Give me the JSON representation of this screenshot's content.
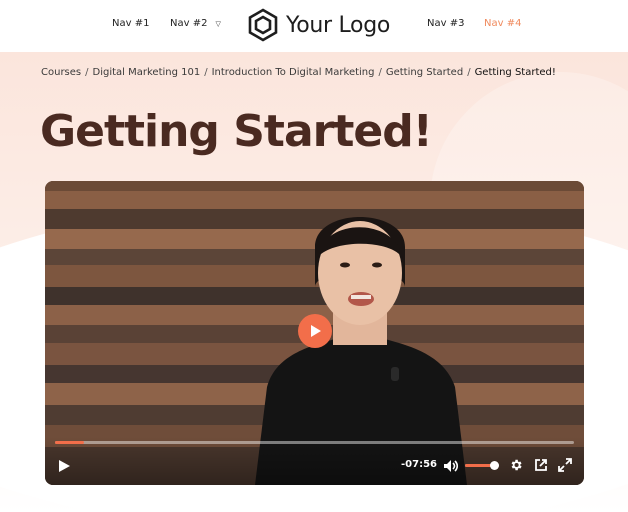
{
  "header": {
    "nav": [
      {
        "label": "Nav #1"
      },
      {
        "label": "Nav #2",
        "has_dropdown": true
      },
      {
        "label": "Nav #3"
      },
      {
        "label": "Nav #4",
        "active": true
      }
    ],
    "logo_text": "Your Logo",
    "logo_icon": "hexagon-icon"
  },
  "breadcrumb": [
    "Courses",
    "Digital Marketing 101",
    "Introduction To Digital Marketing",
    "Getting Started",
    "Getting Started!"
  ],
  "breadcrumb_separator": "/",
  "page_title": "Getting Started!",
  "video": {
    "time_remaining": "-07:56",
    "progress": 0.055,
    "volume": 0.85
  },
  "colors": {
    "accent": "#f26e4a",
    "nav_active": "#f08a5d",
    "title": "#4a2a21",
    "hero_bg": "#fbe5dc"
  }
}
